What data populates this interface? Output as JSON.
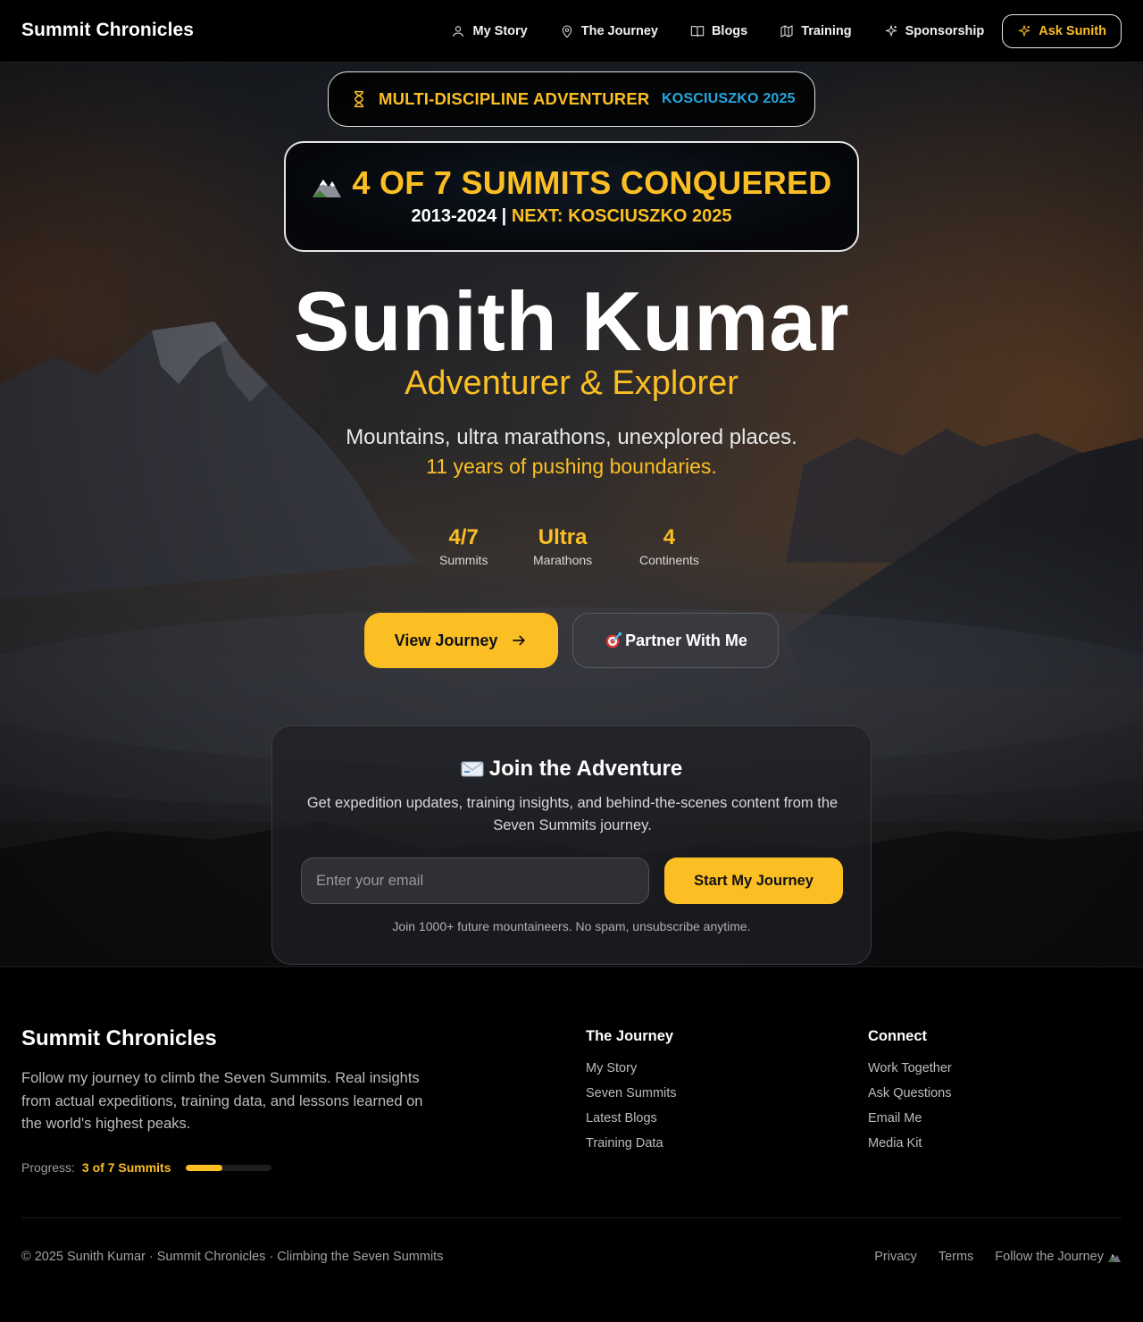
{
  "nav": {
    "brand": "Summit Chronicles",
    "links": [
      {
        "label": "My Story",
        "icon": "user-icon"
      },
      {
        "label": "The Journey",
        "icon": "map-pin-icon"
      },
      {
        "label": "Blogs",
        "icon": "book-icon"
      },
      {
        "label": "Training",
        "icon": "map-icon"
      },
      {
        "label": "Sponsorship",
        "icon": "sparkles-icon"
      }
    ],
    "cta": {
      "label": "Ask Sunith",
      "icon": "sparkles-icon"
    }
  },
  "hero": {
    "badge": {
      "primary": "MULTI-DISCIPLINE ADVENTURER",
      "secondary": "KOSCIUSZKO 2025",
      "icon": "hourglass-icon"
    },
    "summits": {
      "title": "4 OF 7 SUMMITS CONQUERED",
      "years": "2013-2024 |",
      "next": "NEXT: KOSCIUSZKO 2025",
      "icon": "mountain-emoji"
    },
    "name": "Sunith Kumar",
    "role": "Adventurer & Explorer",
    "tagline_1": "Mountains, ultra marathons, unexplored places.",
    "tagline_2": "11 years of pushing boundaries.",
    "stats": [
      {
        "value": "4/7",
        "label": "Summits"
      },
      {
        "value": "Ultra",
        "label": "Marathons"
      },
      {
        "value": "4",
        "label": "Continents"
      }
    ],
    "buttons": {
      "primary": "View Journey",
      "secondary": "Partner With Me"
    }
  },
  "newsletter": {
    "title": "Join the Adventure",
    "description": "Get expedition updates, training insights, and behind-the-scenes content from the Seven Summits journey.",
    "placeholder": "Enter your email",
    "button": "Start My Journey",
    "note": "Join 1000+ future mountaineers. No spam, unsubscribe anytime."
  },
  "footer": {
    "brand": "Summit Chronicles",
    "description": "Follow my journey to climb the Seven Summits. Real insights from actual expeditions, training data, and lessons learned on the world's highest peaks.",
    "progress": {
      "label": "Progress:",
      "value": "3 of 7 Summits",
      "fraction": 0.43
    },
    "columns": [
      {
        "title": "The Journey",
        "links": [
          "My Story",
          "Seven Summits",
          "Latest Blogs",
          "Training Data"
        ]
      },
      {
        "title": "Connect",
        "links": [
          "Work Together",
          "Ask Questions",
          "Email Me",
          "Media Kit"
        ]
      }
    ],
    "copyright": "© 2025 Sunith Kumar · Summit Chronicles · Climbing the Seven Summits",
    "bottom_links": [
      "Privacy",
      "Terms",
      "Follow the Journey"
    ]
  },
  "colors": {
    "accent": "#fbbf24",
    "secondary_accent": "#22a7e0",
    "background": "#000000"
  }
}
